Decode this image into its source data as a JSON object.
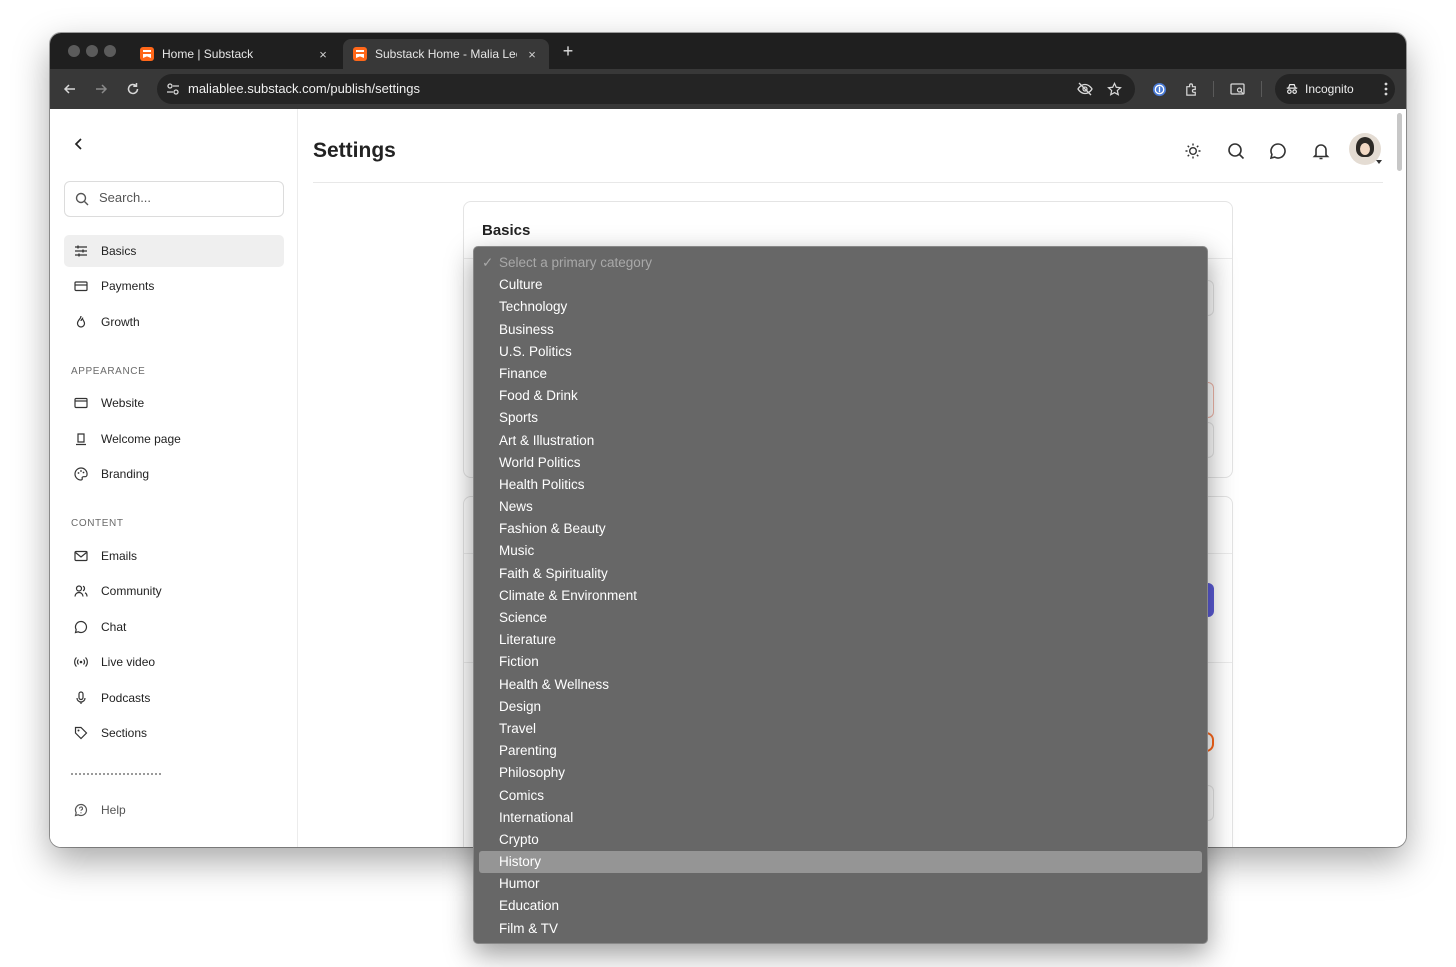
{
  "browser": {
    "tabs": [
      {
        "title": "Home | Substack",
        "close": "×"
      },
      {
        "title": "Substack Home - Malia Lee",
        "close": "×"
      }
    ],
    "new_tab": "+",
    "url": "maliablee.substack.com/publish/settings",
    "incognito_label": "Incognito"
  },
  "sidebar": {
    "search_placeholder": "Search...",
    "items_top": [
      {
        "label": "Basics",
        "icon": "sliders-icon",
        "active": true
      },
      {
        "label": "Payments",
        "icon": "credit-card-icon"
      },
      {
        "label": "Growth",
        "icon": "flame-icon"
      }
    ],
    "appearance_label": "APPEARANCE",
    "items_appearance": [
      {
        "label": "Website",
        "icon": "browser-window-icon"
      },
      {
        "label": "Welcome page",
        "icon": "lamp-icon"
      },
      {
        "label": "Branding",
        "icon": "palette-icon"
      }
    ],
    "content_label": "CONTENT",
    "items_content": [
      {
        "label": "Emails",
        "icon": "mail-icon"
      },
      {
        "label": "Community",
        "icon": "users-icon"
      },
      {
        "label": "Chat",
        "icon": "chat-bubble-icon"
      },
      {
        "label": "Live video",
        "icon": "broadcast-icon"
      },
      {
        "label": "Podcasts",
        "icon": "microphone-icon"
      },
      {
        "label": "Sections",
        "icon": "tag-icon"
      }
    ],
    "help_label": "Help"
  },
  "main": {
    "title": "Settings",
    "card_title": "Basics"
  },
  "dropdown": {
    "check": "✓",
    "placeholder": "Select a primary category",
    "highlighted": "History",
    "options": [
      "Culture",
      "Technology",
      "Business",
      "U.S. Politics",
      "Finance",
      "Food & Drink",
      "Sports",
      "Art & Illustration",
      "World Politics",
      "Health Politics",
      "News",
      "Fashion & Beauty",
      "Music",
      "Faith & Spirituality",
      "Climate & Environment",
      "Science",
      "Literature",
      "Fiction",
      "Health & Wellness",
      "Design",
      "Travel",
      "Parenting",
      "Philosophy",
      "Comics",
      "International",
      "Crypto",
      "History",
      "Humor",
      "Education",
      "Film & TV"
    ]
  },
  "colors": {
    "brand_orange": "#ff6719",
    "dropdown_bg": "#676767",
    "dropdown_highlight": "#959595",
    "chrome_dark": "#1f1f1f"
  }
}
